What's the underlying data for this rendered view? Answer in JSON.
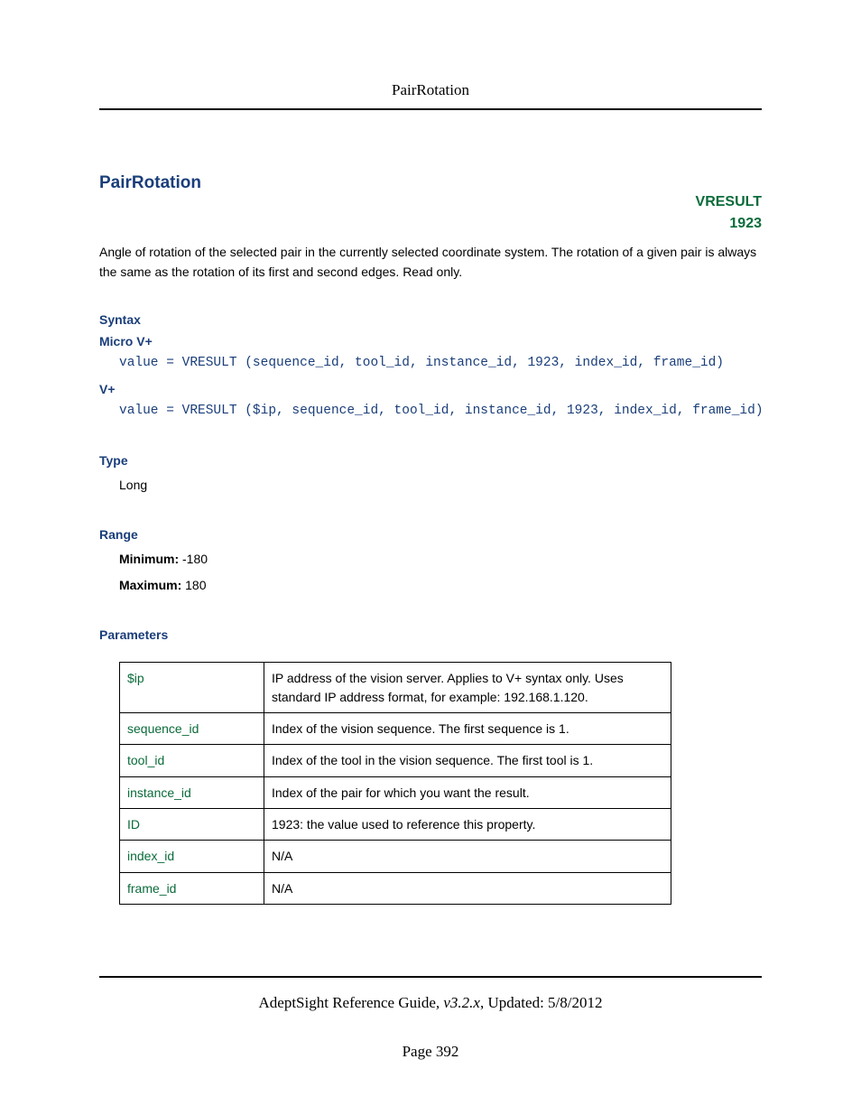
{
  "header": {
    "running_title": "PairRotation"
  },
  "title": "PairRotation",
  "tag": {
    "name": "VRESULT",
    "code": "1923"
  },
  "description": "Angle of rotation of the selected pair in the currently selected coordinate system. The rotation of a given pair is always the same as the rotation of its first and second edges. Read only.",
  "syntax": {
    "heading": "Syntax",
    "micro_label": "Micro V+",
    "micro_code": "value = VRESULT (sequence_id, tool_id, instance_id, 1923, index_id, frame_id)",
    "vplus_label": "V+",
    "vplus_code": "value = VRESULT ($ip, sequence_id, tool_id, instance_id, 1923, index_id, frame_id)"
  },
  "type": {
    "heading": "Type",
    "value": "Long"
  },
  "range": {
    "heading": "Range",
    "min_label": "Minimum:",
    "min_value": "-180",
    "max_label": "Maximum:",
    "max_value": "180"
  },
  "parameters": {
    "heading": "Parameters",
    "rows": [
      {
        "name": "$ip",
        "desc": "IP address of the vision server. Applies to V+ syntax only. Uses standard IP address format, for example: 192.168.1.120."
      },
      {
        "name": "sequence_id",
        "desc": "Index of the vision sequence. The first sequence is 1."
      },
      {
        "name": "tool_id",
        "desc": "Index of the tool in the vision sequence. The first tool is 1."
      },
      {
        "name": "instance_id",
        "desc": "Index of the pair for which you want the result."
      },
      {
        "name": "ID",
        "desc": "1923: the value used to reference this property."
      },
      {
        "name": "index_id",
        "desc": "N/A"
      },
      {
        "name": "frame_id",
        "desc": "N/A"
      }
    ]
  },
  "footer": {
    "doc_title": "AdeptSight Reference Guide",
    "version": ", v3.2.x",
    "updated": ", Updated: 5/8/2012",
    "page_label": "Page 392"
  }
}
